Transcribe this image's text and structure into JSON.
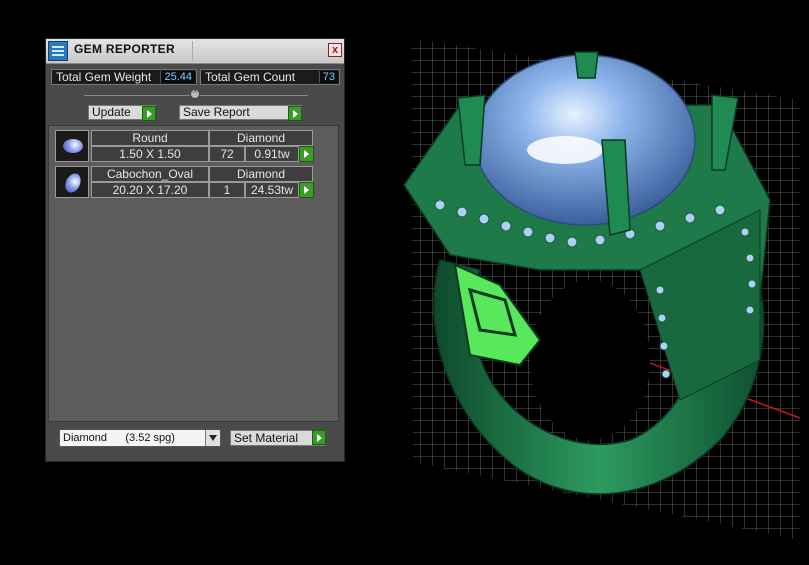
{
  "panel": {
    "title": "GEM REPORTER",
    "close_label": "x",
    "stats": {
      "weight_label": "Total Gem Weight",
      "weight_value": "25.44",
      "count_label": "Total Gem Count",
      "count_value": "73"
    },
    "buttons": {
      "update": "Update",
      "save_report": "Save Report"
    },
    "gems": [
      {
        "shape": "Round",
        "material": "Diamond",
        "size": "1.50 X 1.50",
        "count": "72",
        "weight": "0.91tw"
      },
      {
        "shape": "Cabochon_Oval",
        "material": "Diamond",
        "size": "20.20 X 17.20",
        "count": "1",
        "weight": "24.53tw"
      }
    ],
    "material_select": "Diamond      (3.52 spg)",
    "set_material": "Set Material"
  },
  "colors": {
    "ring": "#1f7a4a",
    "gem": "#7fa8e0",
    "accent_green": "#3c9a2a",
    "value_text": "#6fd1ff"
  }
}
